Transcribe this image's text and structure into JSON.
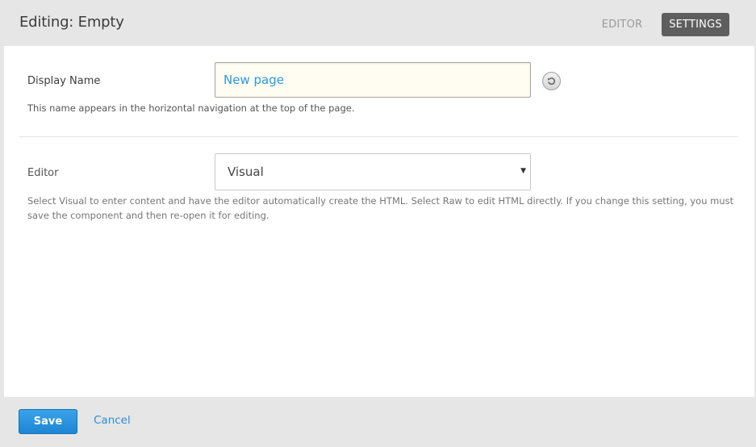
{
  "header": {
    "title": "Editing: Empty",
    "tabs": [
      {
        "label": "EDITOR",
        "active": false
      },
      {
        "label": "SETTINGS",
        "active": true
      }
    ]
  },
  "settings": {
    "display_name": {
      "label": "Display Name",
      "value": "New page",
      "help": "This name appears in the horizontal navigation at the top of the page.",
      "reset_icon": "reset-icon"
    },
    "editor": {
      "label": "Editor",
      "selected": "Visual",
      "help": "Select Visual to enter content and have the editor automatically create the HTML. Select Raw to edit HTML directly. If you change this setting, you must save the component and then re-open it for editing."
    }
  },
  "footer": {
    "save_label": "Save",
    "cancel_label": "Cancel"
  },
  "colors": {
    "accent": "#2a8fd8",
    "active_tab": "#5e5e5e",
    "background": "#e6e6e6"
  }
}
